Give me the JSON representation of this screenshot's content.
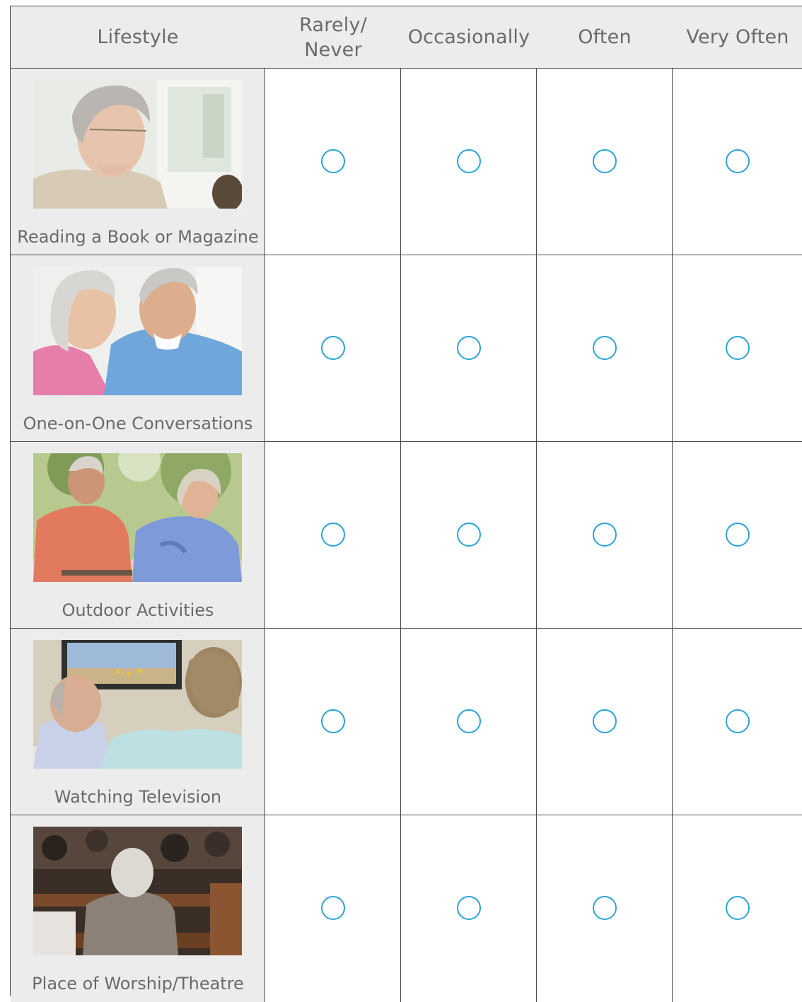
{
  "header": {
    "lifestyle": "Lifestyle",
    "rarely_never": "Rarely/\nNever",
    "occasionally": "Occasionally",
    "often": "Often",
    "very_often": "Very Often"
  },
  "rows": [
    {
      "label": "Reading a Book or Magazine"
    },
    {
      "label": "One-on-One Conversations"
    },
    {
      "label": "Outdoor Activities"
    },
    {
      "label": "Watching Television"
    },
    {
      "label": "Place of Worship/Theatre"
    }
  ],
  "colors": {
    "radio_border": "#2aa3d8",
    "header_bg": "#ececed",
    "text": "#6a6a6a",
    "grid": "#4a4a4a"
  },
  "icons": [
    "radio-option-icon"
  ]
}
